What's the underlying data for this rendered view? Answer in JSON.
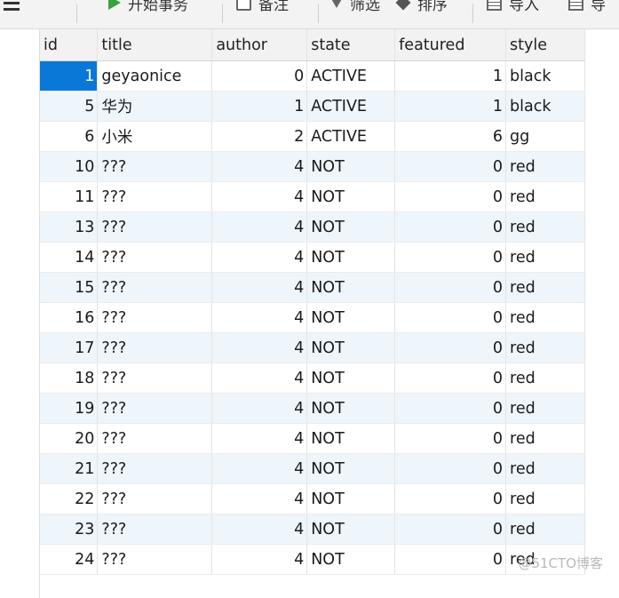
{
  "toolbar": {
    "items": [
      {
        "label": "开始事务",
        "icon": "play-icon"
      },
      {
        "label": "备注",
        "icon": "note-icon"
      },
      {
        "label": "筛选",
        "icon": "filter-icon"
      },
      {
        "label": "排序",
        "icon": "sort-icon"
      },
      {
        "label": "导入",
        "icon": "import-icon"
      },
      {
        "label": "导",
        "icon": "export-icon"
      }
    ]
  },
  "table": {
    "columns": [
      "id",
      "title",
      "author",
      "state",
      "featured",
      "style"
    ],
    "rows": [
      {
        "id": "1",
        "title": "geyaonice",
        "author": "0",
        "state": "ACTIVE",
        "featured": "1",
        "style": "black"
      },
      {
        "id": "5",
        "title": "华为",
        "author": "1",
        "state": "ACTIVE",
        "featured": "1",
        "style": "black"
      },
      {
        "id": "6",
        "title": "小米",
        "author": "2",
        "state": "ACTIVE",
        "featured": "6",
        "style": "gg"
      },
      {
        "id": "10",
        "title": "???",
        "author": "4",
        "state": "NOT",
        "featured": "0",
        "style": "red"
      },
      {
        "id": "11",
        "title": "???",
        "author": "4",
        "state": "NOT",
        "featured": "0",
        "style": "red"
      },
      {
        "id": "13",
        "title": "???",
        "author": "4",
        "state": "NOT",
        "featured": "0",
        "style": "red"
      },
      {
        "id": "14",
        "title": "???",
        "author": "4",
        "state": "NOT",
        "featured": "0",
        "style": "red"
      },
      {
        "id": "15",
        "title": "???",
        "author": "4",
        "state": "NOT",
        "featured": "0",
        "style": "red"
      },
      {
        "id": "16",
        "title": "???",
        "author": "4",
        "state": "NOT",
        "featured": "0",
        "style": "red"
      },
      {
        "id": "17",
        "title": "???",
        "author": "4",
        "state": "NOT",
        "featured": "0",
        "style": "red"
      },
      {
        "id": "18",
        "title": "???",
        "author": "4",
        "state": "NOT",
        "featured": "0",
        "style": "red"
      },
      {
        "id": "19",
        "title": "???",
        "author": "4",
        "state": "NOT",
        "featured": "0",
        "style": "red"
      },
      {
        "id": "20",
        "title": "???",
        "author": "4",
        "state": "NOT",
        "featured": "0",
        "style": "red"
      },
      {
        "id": "21",
        "title": "???",
        "author": "4",
        "state": "NOT",
        "featured": "0",
        "style": "red"
      },
      {
        "id": "22",
        "title": "???",
        "author": "4",
        "state": "NOT",
        "featured": "0",
        "style": "red"
      },
      {
        "id": "23",
        "title": "???",
        "author": "4",
        "state": "NOT",
        "featured": "0",
        "style": "red"
      },
      {
        "id": "24",
        "title": "???",
        "author": "4",
        "state": "NOT",
        "featured": "0",
        "style": "red"
      }
    ],
    "selected_row": 0,
    "selection_color": "#0a78d7"
  },
  "watermark": "@51CTO博客"
}
